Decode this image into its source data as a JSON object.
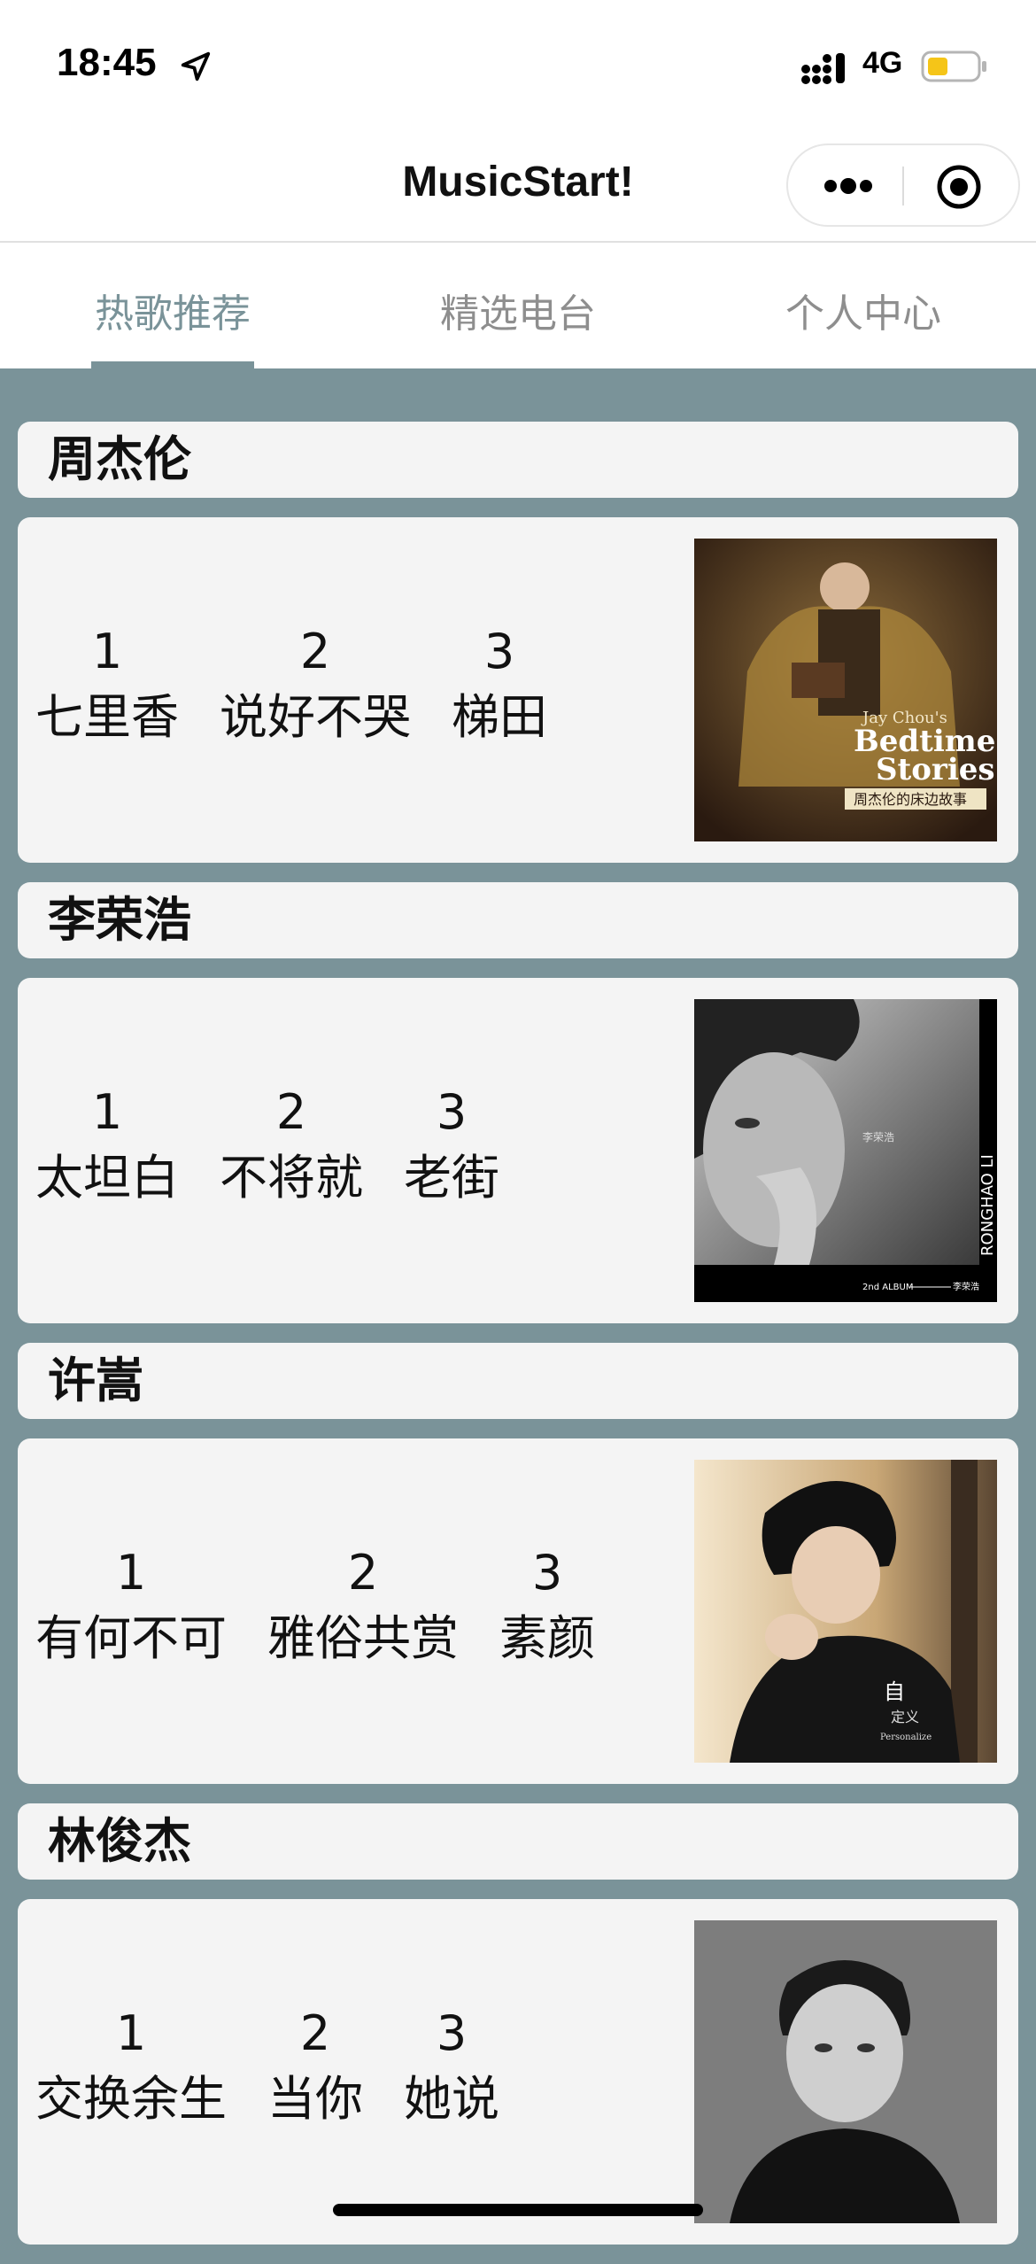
{
  "status_bar": {
    "time": "18:45",
    "network": "4G",
    "icons": [
      "location-arrow-icon",
      "signal-icon",
      "battery-icon"
    ],
    "battery_color": "#f5c518"
  },
  "nav": {
    "title": "MusicStart!",
    "icons": [
      "more-icon",
      "target-icon"
    ]
  },
  "tabs": [
    {
      "label": "热歌推荐",
      "active": true
    },
    {
      "label": "精选电台",
      "active": false
    },
    {
      "label": "个人中心",
      "active": false
    }
  ],
  "colors": {
    "accent": "#7a9399",
    "card_bg": "#f4f4f4",
    "page_bg": "#7a9399"
  },
  "artists": [
    {
      "name": "周杰伦",
      "songs": [
        {
          "rank": "1",
          "title": "七里香"
        },
        {
          "rank": "2",
          "title": "说好不哭"
        },
        {
          "rank": "3",
          "title": "梯田"
        }
      ],
      "cover_text": [
        "Jay Chou's",
        "Bedtime",
        "Stories",
        "周杰伦的床边故事"
      ]
    },
    {
      "name": "李荣浩",
      "songs": [
        {
          "rank": "1",
          "title": "太坦白"
        },
        {
          "rank": "2",
          "title": "不将就"
        },
        {
          "rank": "3",
          "title": "老街"
        }
      ],
      "cover_text": [
        "RONGHAO LI",
        "李荣浩",
        "2nd ALBUM",
        "李荣浩"
      ]
    },
    {
      "name": "许嵩",
      "songs": [
        {
          "rank": "1",
          "title": "有何不可"
        },
        {
          "rank": "2",
          "title": "雅俗共赏"
        },
        {
          "rank": "3",
          "title": "素颜"
        }
      ],
      "cover_text": [
        "自",
        "定义",
        "Personalize"
      ]
    },
    {
      "name": "林俊杰",
      "songs": [
        {
          "rank": "1",
          "title": "交换余生"
        },
        {
          "rank": "2",
          "title": "当你"
        },
        {
          "rank": "3",
          "title": "她说"
        }
      ],
      "cover_text": []
    }
  ]
}
